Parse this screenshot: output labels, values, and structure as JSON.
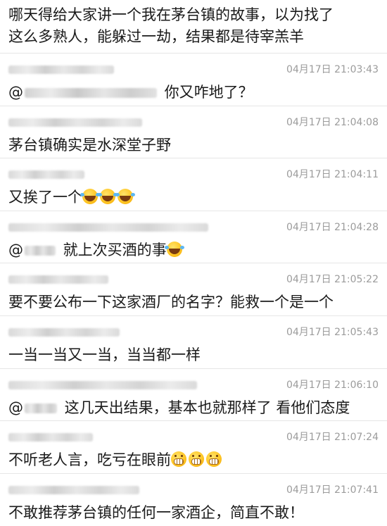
{
  "top_message": {
    "lines": [
      "哪天得给大家讲一个我在茅台镇的故事，以为找了",
      "这么多熟人，能躲过一劫，结果都是待宰羔羊"
    ]
  },
  "comments": [
    {
      "timestamp": "04月17日 21:03:43",
      "mention": "@",
      "text": " 你又咋地了？",
      "emoji": ""
    },
    {
      "timestamp": "04月17日 21:04:08",
      "mention": "",
      "text": "茅台镇确实是水深堂子野",
      "emoji": ""
    },
    {
      "timestamp": "04月17日 21:04:11",
      "mention": "",
      "text": "又挨了一个",
      "emoji": "face-with-tears-of-joy-icon x3"
    },
    {
      "timestamp": "04月17日 21:04:28",
      "mention": "@",
      "text": " 就上次买酒的事",
      "emoji": "face-with-tears-of-joy-icon x1"
    },
    {
      "timestamp": "04月17日 21:05:22",
      "mention": "",
      "text": "要不要公布一下这家酒厂的名字？能救一个是一个",
      "emoji": ""
    },
    {
      "timestamp": "04月17日 21:05:43",
      "mention": "",
      "text": "一当一当又一当，当当都一样",
      "emoji": ""
    },
    {
      "timestamp": "04月17日 21:06:10",
      "mention": "@",
      "text": " 这几天出结果，基本也就那样了 看他们态度",
      "emoji": ""
    },
    {
      "timestamp": "04月17日 21:07:24",
      "mention": "",
      "text": "不听老人言，吃亏在眼前",
      "emoji": "grinning-face-icon x3"
    },
    {
      "timestamp": "04月17日 21:07:41",
      "mention": "",
      "text": "不敢推荐茅台镇的任何一家酒企，简直不敢！",
      "emoji": ""
    }
  ],
  "colors": {
    "text": "#1a1a1a",
    "timestamp": "#9b9b9b",
    "divider": "#e6e6e6",
    "background": "#ffffff"
  }
}
